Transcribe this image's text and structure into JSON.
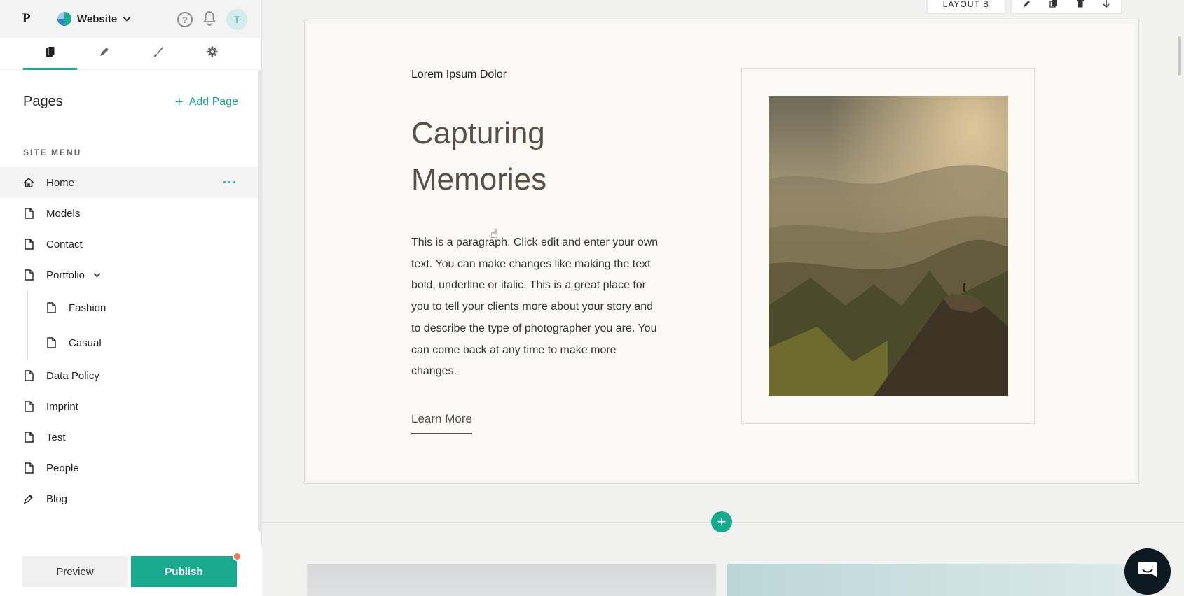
{
  "app": {
    "logo": "P",
    "site_name": "Website",
    "avatar_initial": "T",
    "accent_color": "#18a98f"
  },
  "tabs": [
    {
      "name": "pages-tab",
      "icon": "pages-icon"
    },
    {
      "name": "blog-tab",
      "icon": "pen-icon"
    },
    {
      "name": "design-tab",
      "icon": "brush-icon"
    },
    {
      "name": "settings-tab",
      "icon": "gear-icon"
    }
  ],
  "pages": {
    "title": "Pages",
    "add_label": "Add Page",
    "site_menu_label": "SITE MENU",
    "items": [
      {
        "label": "Home",
        "icon": "home-icon"
      },
      {
        "label": "Models",
        "icon": "page-icon"
      },
      {
        "label": "Contact",
        "icon": "page-icon"
      },
      {
        "label": "Portfolio",
        "icon": "page-icon"
      },
      {
        "label": "Fashion",
        "icon": "page-icon"
      },
      {
        "label": "Casual",
        "icon": "page-icon"
      },
      {
        "label": "Data Policy",
        "icon": "page-icon"
      },
      {
        "label": "Imprint",
        "icon": "page-icon"
      },
      {
        "label": "Test",
        "icon": "page-icon"
      },
      {
        "label": "People",
        "icon": "page-icon"
      },
      {
        "label": "Blog",
        "icon": "pen-icon"
      }
    ],
    "more_glyph": "···"
  },
  "footer": {
    "preview_label": "Preview",
    "publish_label": "Publish"
  },
  "section": {
    "layout_label": "LAYOUT B",
    "eyebrow": "Lorem Ipsum Dolor",
    "title_line1": "Capturing",
    "title_line2": "Memories",
    "paragraph": "This is a paragraph. Click edit and enter your own text. You can make changes like making the text bold, underline or italic. This is a great place for you to tell your clients more about your story and to describe the type of photographer you are. You can come back at any time to make more changes.",
    "button_label": "Learn More",
    "add_section_glyph": "+"
  }
}
